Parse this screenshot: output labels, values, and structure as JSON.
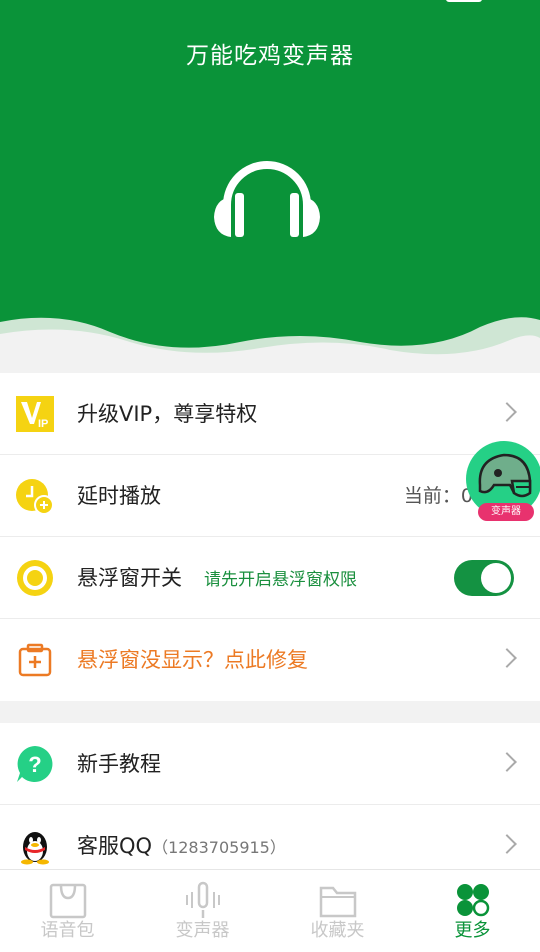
{
  "header": {
    "title": "万能吃鸡变声器"
  },
  "menu1": [
    {
      "label": "升级VIP，尊享特权",
      "icon": "vip-icon"
    },
    {
      "label": "延时播放",
      "value": "当前：0秒",
      "icon": "clock-icon"
    },
    {
      "label": "悬浮窗开关",
      "sub": "请先开启悬浮窗权限",
      "icon": "float-window-icon",
      "toggle_on": true
    },
    {
      "label": "悬浮窗没显示？点此修复",
      "icon": "repair-icon"
    }
  ],
  "menu2": [
    {
      "label": "新手教程",
      "icon": "help-icon"
    },
    {
      "label": "客服QQ",
      "qq": "（1283705915）",
      "icon": "qq-penguin-icon"
    }
  ],
  "float_ball": {
    "tag": "变声器",
    "icon": "helmet-icon"
  },
  "tabs": [
    {
      "label": "语音包",
      "icon": "shopping-bag-icon",
      "active": false
    },
    {
      "label": "变声器",
      "icon": "microphone-wave-icon",
      "active": false
    },
    {
      "label": "收藏夹",
      "icon": "folder-icon",
      "active": false
    },
    {
      "label": "更多",
      "icon": "clover-icon",
      "active": true
    }
  ],
  "colors": {
    "primary": "#0a9339",
    "accent_yellow": "#f5d312",
    "orange": "#ec7a24",
    "teal": "#25d086",
    "pink": "#e8326e"
  }
}
